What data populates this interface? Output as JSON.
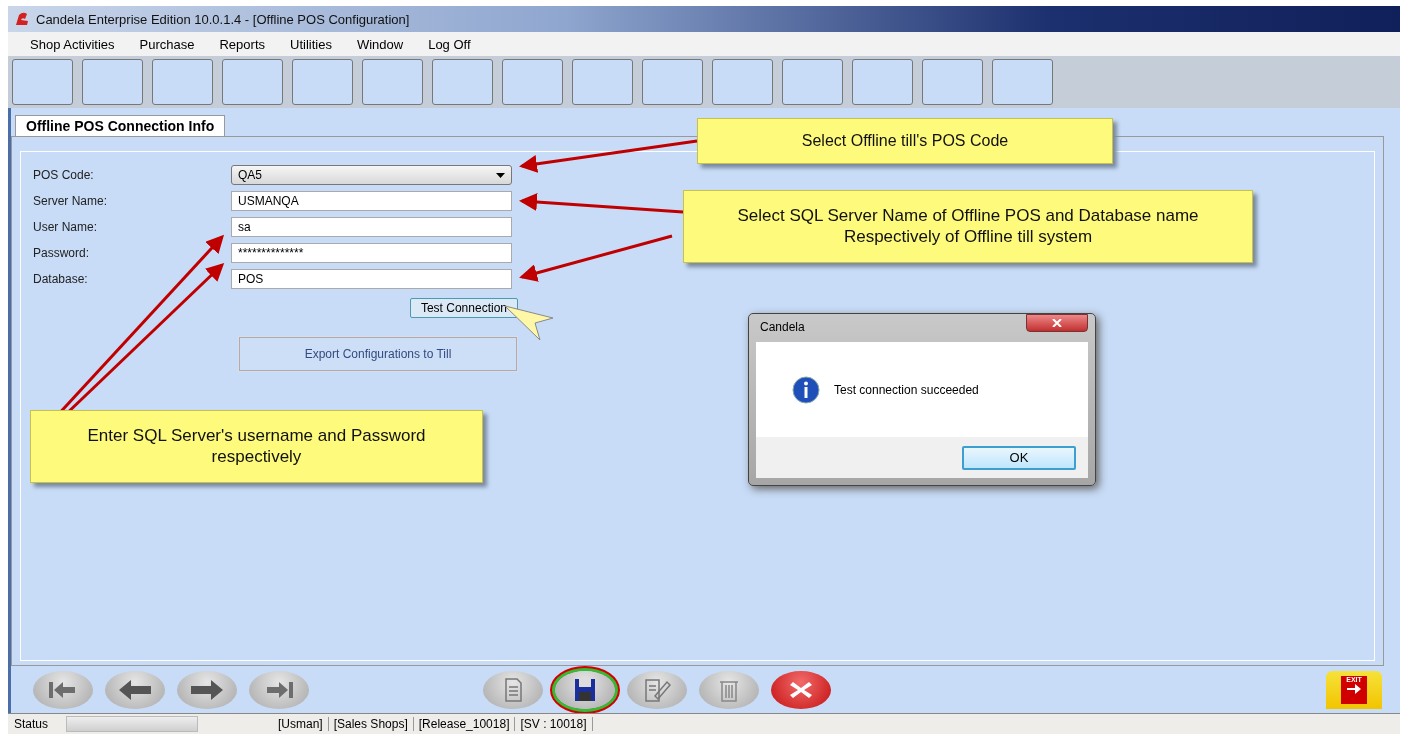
{
  "window": {
    "title": "Candela Enterprise Edition 10.0.1.4 - [Offline POS Configuration]"
  },
  "menu": [
    "Shop Activities",
    "Purchase",
    "Reports",
    "Utilities",
    "Window",
    "Log Off"
  ],
  "tabs": [
    {
      "label": "Offline POS Connection Info",
      "selected": true
    }
  ],
  "form": {
    "fields": [
      {
        "label": "POS Code:",
        "value": "QA5",
        "kind": "dropdown"
      },
      {
        "label": "Server Name:",
        "value": "USMANQA",
        "kind": "text"
      },
      {
        "label": "User Name:",
        "value": "sa",
        "kind": "text"
      },
      {
        "label": "Password:",
        "value": "**************",
        "kind": "text"
      },
      {
        "label": "Database:",
        "value": "POS",
        "kind": "text"
      }
    ],
    "test_button": "Test Connection",
    "export_button": "Export Configurations to Till"
  },
  "callouts": [
    "Select Offline till's POS Code",
    "Select SQL Server Name of Offline POS and Database name Respectively of Offline till system",
    "Enter SQL Server's username and Password respectively"
  ],
  "dialog": {
    "title": "Candela",
    "message": "Test connection succeeded",
    "ok": "OK"
  },
  "nav_buttons": [
    {
      "kind": "first",
      "highlighted": false
    },
    {
      "kind": "previous",
      "highlighted": false
    },
    {
      "kind": "next",
      "highlighted": false
    },
    {
      "kind": "last",
      "highlighted": false
    },
    {
      "kind": "new",
      "highlighted": false
    },
    {
      "kind": "save",
      "highlighted": true
    },
    {
      "kind": "edit",
      "highlighted": false
    },
    {
      "kind": "delete",
      "highlighted": false
    },
    {
      "kind": "cancel",
      "highlighted": false
    }
  ],
  "exit_label": "EXIT",
  "status_bar": {
    "label": "Status",
    "progress": {
      "level": 0
    },
    "items": [
      "[Usman]",
      "[Sales Shops]",
      "[Release_10018]",
      "[SV : 10018]"
    ]
  }
}
